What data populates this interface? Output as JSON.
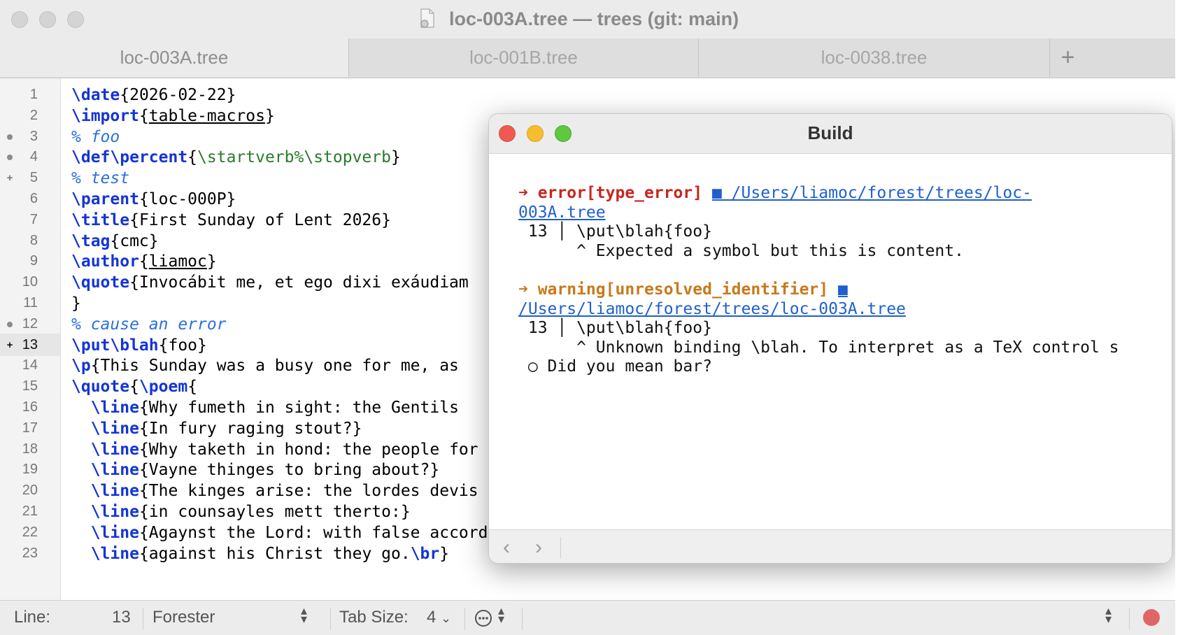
{
  "window": {
    "title": "loc-003A.tree — trees (git: main)",
    "icon": "document-icon"
  },
  "tabs": [
    {
      "label": "loc-003A.tree",
      "active": true
    },
    {
      "label": "loc-001B.tree",
      "active": false
    },
    {
      "label": "loc-0038.tree",
      "active": false
    }
  ],
  "tab_add_label": "+",
  "editor": {
    "current_line": 13,
    "gutter": [
      {
        "n": "1",
        "mark": ""
      },
      {
        "n": "2",
        "mark": ""
      },
      {
        "n": "3",
        "mark": "dot"
      },
      {
        "n": "4",
        "mark": "dot"
      },
      {
        "n": "5",
        "mark": "plus"
      },
      {
        "n": "6",
        "mark": ""
      },
      {
        "n": "7",
        "mark": ""
      },
      {
        "n": "8",
        "mark": ""
      },
      {
        "n": "9",
        "mark": ""
      },
      {
        "n": "10",
        "mark": ""
      },
      {
        "n": "11",
        "mark": ""
      },
      {
        "n": "12",
        "mark": "dot"
      },
      {
        "n": "13",
        "mark": "plus"
      },
      {
        "n": "14",
        "mark": ""
      },
      {
        "n": "15",
        "mark": ""
      },
      {
        "n": "16",
        "mark": ""
      },
      {
        "n": "17",
        "mark": ""
      },
      {
        "n": "18",
        "mark": ""
      },
      {
        "n": "19",
        "mark": ""
      },
      {
        "n": "20",
        "mark": ""
      },
      {
        "n": "21",
        "mark": ""
      },
      {
        "n": "22",
        "mark": ""
      },
      {
        "n": "23",
        "mark": ""
      }
    ],
    "lines": [
      [
        {
          "t": "\\date",
          "c": "kw"
        },
        {
          "t": "{2026-02-22}"
        }
      ],
      [
        {
          "t": "\\import",
          "c": "kw"
        },
        {
          "t": "{"
        },
        {
          "t": "table-macros",
          "c": "ul"
        },
        {
          "t": "}"
        }
      ],
      [
        {
          "t": "% foo",
          "c": "cm"
        }
      ],
      [
        {
          "t": "\\def",
          "c": "kw"
        },
        {
          "t": "\\percent",
          "c": "kw"
        },
        {
          "t": "{"
        },
        {
          "t": "\\startverb%\\stopverb",
          "c": "gr"
        },
        {
          "t": "}"
        }
      ],
      [
        {
          "t": "% test",
          "c": "cm"
        }
      ],
      [
        {
          "t": "\\parent",
          "c": "kw"
        },
        {
          "t": "{loc-000P}"
        }
      ],
      [
        {
          "t": "\\title",
          "c": "kw"
        },
        {
          "t": "{First Sunday of Lent 2026}"
        }
      ],
      [
        {
          "t": "\\tag",
          "c": "kw"
        },
        {
          "t": "{cmc}"
        }
      ],
      [
        {
          "t": "\\author",
          "c": "kw"
        },
        {
          "t": "{"
        },
        {
          "t": "liamoc",
          "c": "ul"
        },
        {
          "t": "}"
        }
      ],
      [
        {
          "t": "\\quote",
          "c": "kw"
        },
        {
          "t": "{Invocábit me, et ego dixi exáudiam"
        }
      ],
      [
        {
          "t": "}"
        }
      ],
      [
        {
          "t": "% cause an error",
          "c": "cm"
        }
      ],
      [
        {
          "t": "\\put",
          "c": "kw"
        },
        {
          "t": "\\blah",
          "c": "kw"
        },
        {
          "t": "{foo}"
        }
      ],
      [
        {
          "t": "\\p",
          "c": "kw"
        },
        {
          "t": "{This Sunday was a busy one for me, as "
        }
      ],
      [
        {
          "t": "\\quote",
          "c": "kw"
        },
        {
          "t": "{"
        },
        {
          "t": "\\poem",
          "c": "kw"
        },
        {
          "t": "{"
        }
      ],
      [
        {
          "t": "  "
        },
        {
          "t": "\\line",
          "c": "kw"
        },
        {
          "t": "{Why fumeth in sight: the Gentils "
        }
      ],
      [
        {
          "t": "  "
        },
        {
          "t": "\\line",
          "c": "kw"
        },
        {
          "t": "{In fury raging stout?}"
        }
      ],
      [
        {
          "t": "  "
        },
        {
          "t": "\\line",
          "c": "kw"
        },
        {
          "t": "{Why taketh in hond: the people for"
        }
      ],
      [
        {
          "t": "  "
        },
        {
          "t": "\\line",
          "c": "kw"
        },
        {
          "t": "{Vayne thinges to bring about?}"
        }
      ],
      [
        {
          "t": "  "
        },
        {
          "t": "\\line",
          "c": "kw"
        },
        {
          "t": "{The kinges arise: the lordes devis"
        }
      ],
      [
        {
          "t": "  "
        },
        {
          "t": "\\line",
          "c": "kw"
        },
        {
          "t": "{in counsayles mett therto:}"
        }
      ],
      [
        {
          "t": "  "
        },
        {
          "t": "\\line",
          "c": "kw"
        },
        {
          "t": "{Agaynst the Lord: with false accord,}"
        }
      ],
      [
        {
          "t": "  "
        },
        {
          "t": "\\line",
          "c": "kw"
        },
        {
          "t": "{against his Christ they go."
        },
        {
          "t": "\\br",
          "c": "kw"
        },
        {
          "t": "}"
        }
      ]
    ]
  },
  "status": {
    "line_label": "Line:",
    "line_value": "13",
    "language": "Forester",
    "tab_size_label": "Tab Size:",
    "tab_size_value": "4",
    "options_icon": "ellipsis-circle-icon",
    "colors": {
      "error_indicator": "#e06666"
    }
  },
  "build": {
    "title": "Build",
    "lines": [
      [
        {
          "t": "➜ error[type_error]",
          "c": "err"
        },
        {
          "t": " "
        },
        {
          "t": "■ /Users/liamoc/forest/trees/loc-",
          "c": "link"
        }
      ],
      [
        {
          "t": "003A.tree",
          "c": "link"
        }
      ],
      [
        {
          "t": " 13 │ \\put\\blah{foo}"
        }
      ],
      [
        {
          "t": "      ^ Expected a symbol but this is content."
        }
      ],
      [
        {
          "t": ""
        }
      ],
      [
        {
          "t": "➜ warning[unresolved_identifier]",
          "c": "warn"
        },
        {
          "t": " "
        },
        {
          "t": "■",
          "c": "link"
        }
      ],
      [
        {
          "t": "/Users/liamoc/forest/trees/loc-003A.tree",
          "c": "link"
        }
      ],
      [
        {
          "t": " 13 │ \\put\\blah{foo}"
        }
      ],
      [
        {
          "t": "      ^ Unknown binding \\blah. To interpret as a TeX control s"
        }
      ],
      [
        {
          "t": " ○ Did you mean bar?"
        }
      ]
    ],
    "nav_back": "‹",
    "nav_forward": "›",
    "colors": {
      "error": "#c7261f",
      "warning": "#c9791b",
      "link": "#1f5fcf"
    }
  }
}
